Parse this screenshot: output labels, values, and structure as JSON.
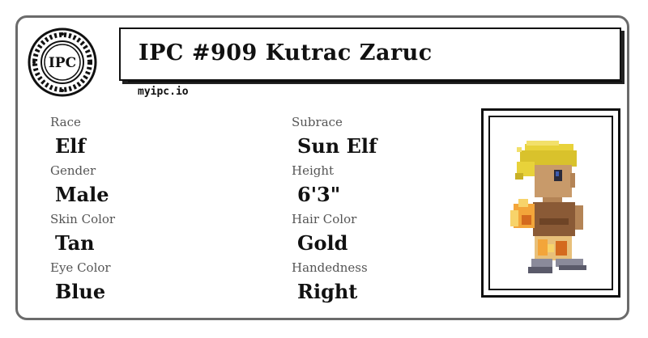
{
  "header": {
    "title": "IPC #909 Kutrac Zaruc",
    "site": "myipc.io",
    "seal_text": "IPC"
  },
  "fields": {
    "race": {
      "label": "Race",
      "value": "Elf"
    },
    "subrace": {
      "label": "Subrace",
      "value": "Sun Elf"
    },
    "gender": {
      "label": "Gender",
      "value": "Male"
    },
    "height": {
      "label": "Height",
      "value": "6'3\""
    },
    "skin_color": {
      "label": "Skin Color",
      "value": "Tan"
    },
    "hair_color": {
      "label": "Hair Color",
      "value": "Gold"
    },
    "eye_color": {
      "label": "Eye Color",
      "value": "Blue"
    },
    "handedness": {
      "label": "Handedness",
      "value": "Right"
    }
  },
  "portrait": {
    "icon": "character-sprite-icon",
    "hair": "#e8d23a",
    "skin": "#c89a6a",
    "tunic": "#8a5a36"
  }
}
